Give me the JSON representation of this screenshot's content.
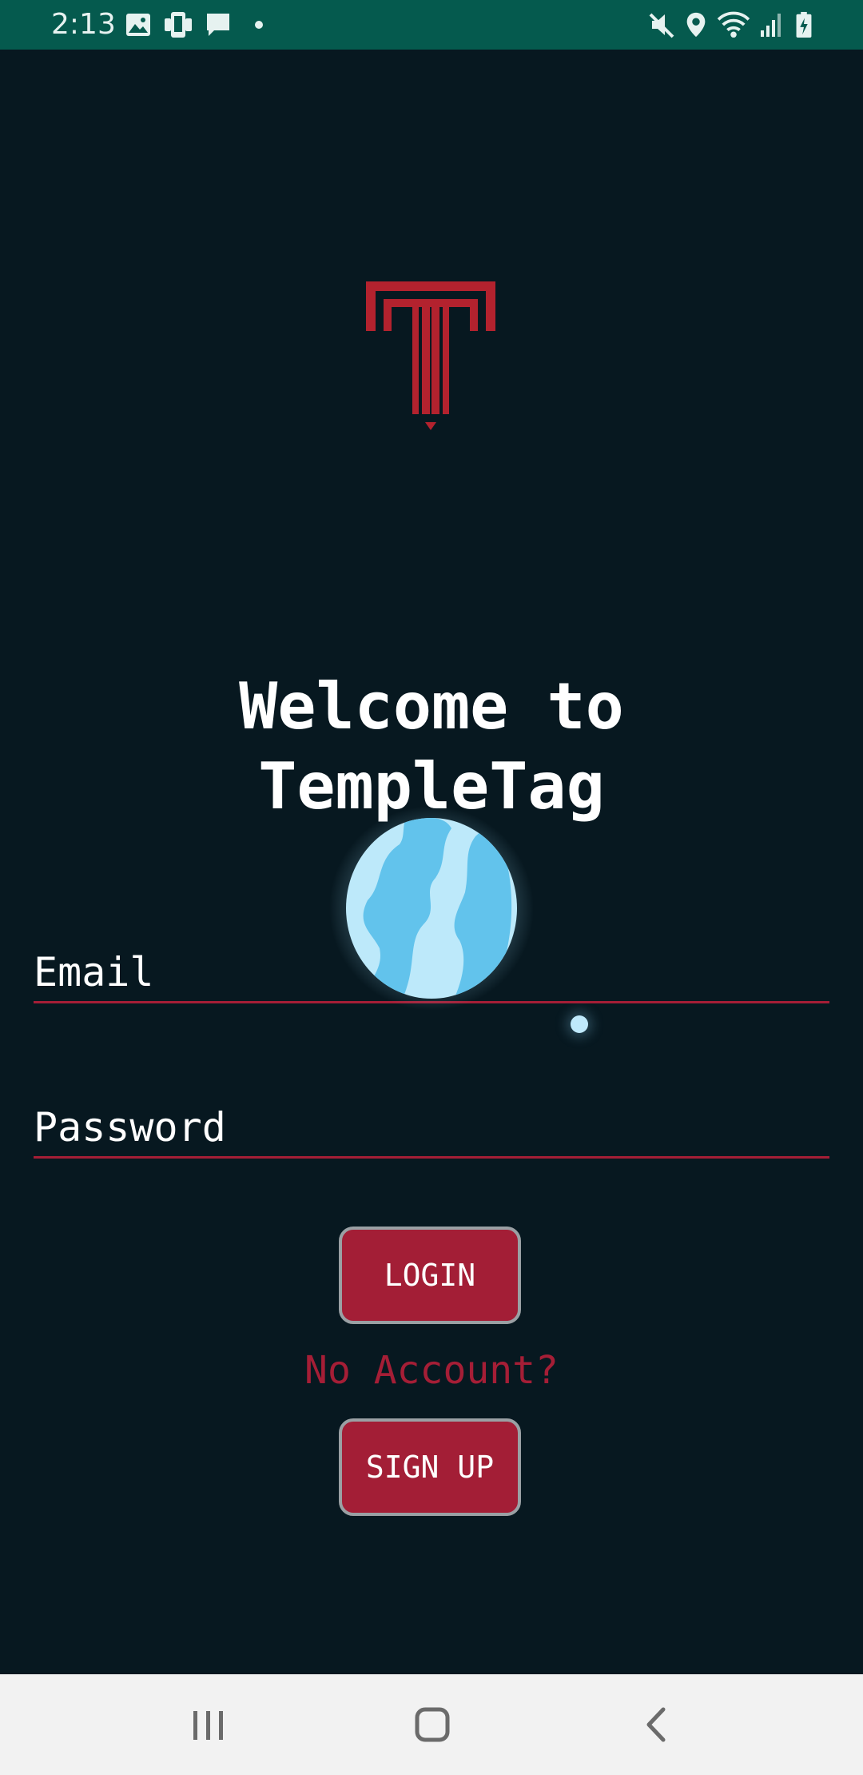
{
  "status_bar": {
    "time": "2:13",
    "left_icons": [
      "image-icon",
      "screen-share-icon",
      "message-icon",
      "dot-icon"
    ],
    "right_icons": [
      "mute-icon",
      "location-icon",
      "wifi-icon",
      "signal-icon",
      "battery-charging-icon"
    ],
    "background": "#055a4e"
  },
  "main": {
    "background": "#071820",
    "title_line1": "Welcome to",
    "title_line2": "TempleTag",
    "email_placeholder": "Email",
    "password_placeholder": "Password",
    "login_label": "LOGIN",
    "no_account_text": "No Account?",
    "signup_label": "SIGN UP",
    "accent_color": "#a31e36"
  },
  "nav_bar": {
    "icons": [
      "recent-apps-icon",
      "home-icon",
      "back-icon"
    ]
  }
}
